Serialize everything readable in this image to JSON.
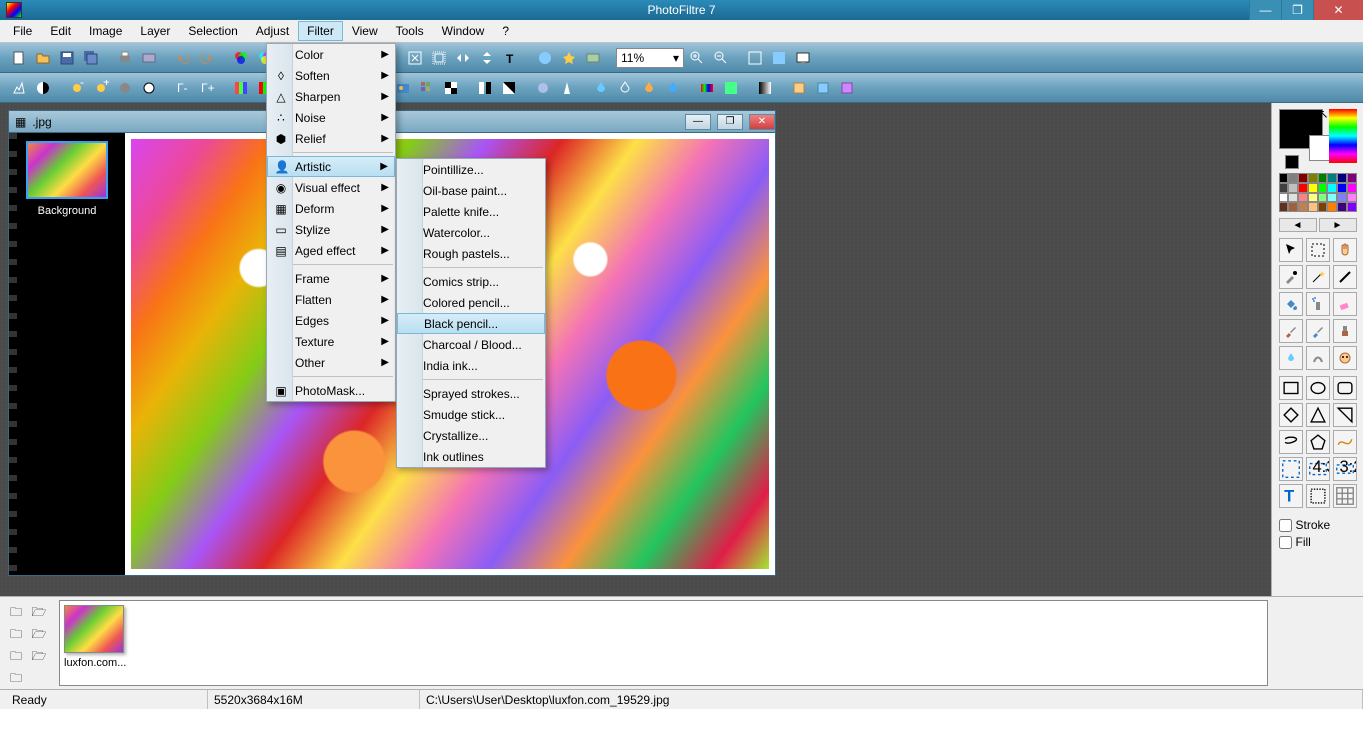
{
  "app": {
    "title": "PhotoFiltre 7"
  },
  "win_controls": {
    "minimize": "—",
    "maximize": "❐",
    "close": "✕"
  },
  "menu": {
    "items": [
      "File",
      "Edit",
      "Image",
      "Layer",
      "Selection",
      "Adjust",
      "Filter",
      "View",
      "Tools",
      "Window",
      "?"
    ],
    "open_index": 6
  },
  "toolbar1": {
    "zoom_value": "11%"
  },
  "filter_menu": {
    "groups": [
      [
        "Color",
        "Soften",
        "Sharpen",
        "Noise",
        "Relief"
      ],
      [
        "Artistic",
        "Visual effect",
        "Deform",
        "Stylize",
        "Aged effect"
      ],
      [
        "Frame",
        "Flatten",
        "Edges",
        "Texture",
        "Other"
      ],
      [
        "PhotoMask..."
      ]
    ],
    "highlighted": "Artistic",
    "icons": {
      "Soften": "◊",
      "Sharpen": "△",
      "Noise": "∴",
      "Relief": "⬢",
      "Artistic": "👤",
      "Visual effect": "◉",
      "Deform": "▦",
      "Stylize": "▭",
      "Aged effect": "▤",
      "PhotoMask...": "▣"
    }
  },
  "artistic_submenu": {
    "groups": [
      [
        "Pointillize...",
        "Oil-base paint...",
        "Palette knife...",
        "Watercolor...",
        "Rough pastels..."
      ],
      [
        "Comics strip...",
        "Colored pencil...",
        "Black pencil...",
        "Charcoal / Blood...",
        "India ink..."
      ],
      [
        "Sprayed strokes...",
        "Smudge stick...",
        "Crystallize...",
        "Ink outlines"
      ]
    ],
    "highlighted": "Black pencil..."
  },
  "document": {
    "title_suffix": ".jpg",
    "minimize": "—",
    "maximize": "❐",
    "close": "✕",
    "layer_label": "Background"
  },
  "palette_colors": [
    "#000000",
    "#808080",
    "#800000",
    "#808000",
    "#008000",
    "#008080",
    "#000080",
    "#800080",
    "#404040",
    "#c0c0c0",
    "#ff0000",
    "#ffff00",
    "#00ff00",
    "#00ffff",
    "#0000ff",
    "#ff00ff",
    "#ffffff",
    "#e0e0e0",
    "#ff8080",
    "#ffff80",
    "#80ff80",
    "#80ffff",
    "#8080ff",
    "#ff80ff",
    "#603020",
    "#a06040",
    "#c08050",
    "#ffc080",
    "#804000",
    "#ff8000",
    "#400080",
    "#8000ff"
  ],
  "palette_nav": {
    "prev": "◄",
    "next": "►"
  },
  "tools": [
    "pointer",
    "selection",
    "hand",
    "picker",
    "wand",
    "line",
    "fill",
    "spray",
    "eraser",
    "brush",
    "advbrush",
    "stamp",
    "blur",
    "smudge",
    "clone"
  ],
  "shapes": [
    "rect",
    "ellipse",
    "roundrect",
    "diamond",
    "triangle",
    "triangle-r",
    "lasso",
    "polygon",
    "freehand",
    "marquee1",
    "marquee2",
    "marquee3",
    "text-tool",
    "crop",
    "grid"
  ],
  "shape_options": {
    "stroke_label": "Stroke",
    "fill_label": "Fill"
  },
  "bottom": {
    "thumb_label": "luxfon.com..."
  },
  "status": {
    "ready": "Ready",
    "dims": "5520x3684x16M",
    "path": "C:\\Users\\User\\Desktop\\luxfon.com_19529.jpg"
  }
}
